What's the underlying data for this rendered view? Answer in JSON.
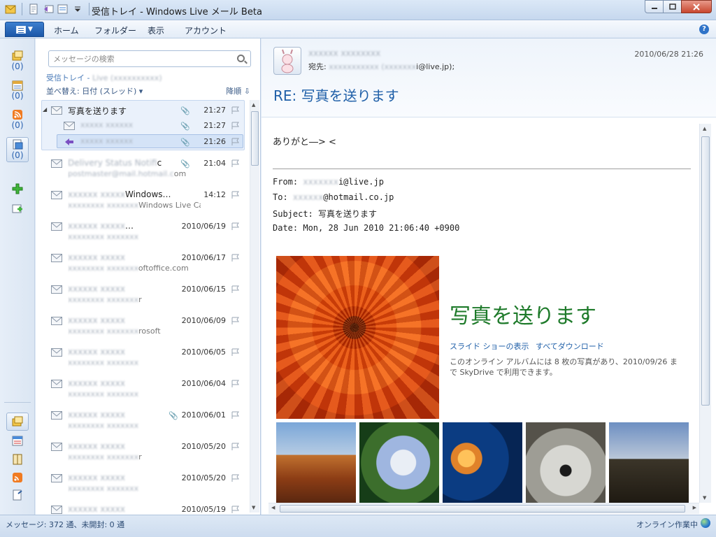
{
  "window": {
    "title": "受信トレイ - Windows Live メール Beta"
  },
  "ribbon": {
    "tabs": [
      "ホーム",
      "フォルダー",
      "表示",
      "アカウント"
    ],
    "help_label": "?"
  },
  "nav_rail": {
    "counts": [
      "(0)",
      "(0)",
      "(0)",
      "(0)"
    ]
  },
  "list": {
    "search_placeholder": "メッセージの検索",
    "folder_label": "受信トレイ - ",
    "folder_account": "Live (",
    "folder_account_suffix": ")",
    "sort_label": "並べ替え: 日付 (スレッド) ▾",
    "order_label": "降順 ⇩",
    "thread": {
      "subject": "写真を送ります",
      "time": "21:27",
      "replies": [
        {
          "from": "",
          "time": "21:27"
        },
        {
          "from": "",
          "time": "21:26"
        }
      ]
    },
    "messages": [
      {
        "subject_visible": "ic",
        "subject_hidden": "Delivery Status Notif",
        "from_visible": "om",
        "from_hidden": "postmaster@mail.hotmail.c",
        "time": "21:04",
        "attachment": true
      },
      {
        "subject_visible": "Windows…",
        "subject_hidden": "",
        "from_visible": "Windows Live Cal…",
        "from_hidden": "",
        "time": "14:12",
        "attachment": false
      },
      {
        "subject_visible": "…",
        "subject_hidden": "",
        "from_visible": "",
        "from_hidden": "",
        "time": "2010/06/19",
        "attachment": false
      },
      {
        "subject_visible": "",
        "subject_hidden": "",
        "from_visible": "oftoffice.com",
        "from_hidden": "",
        "time": "2010/06/17",
        "attachment": false
      },
      {
        "subject_visible": "",
        "subject_hidden": "",
        "from_visible": "r",
        "from_hidden": "",
        "time": "2010/06/15",
        "attachment": false
      },
      {
        "subject_visible": "",
        "subject_hidden": "",
        "from_visible": "rosoft",
        "from_hidden": "",
        "time": "2010/06/09",
        "attachment": false
      },
      {
        "subject_visible": "",
        "subject_hidden": "",
        "from_visible": "",
        "from_hidden": "",
        "time": "2010/06/05",
        "attachment": false
      },
      {
        "subject_visible": "",
        "subject_hidden": "",
        "from_visible": "",
        "from_hidden": "",
        "time": "2010/06/04",
        "attachment": false
      },
      {
        "subject_visible": "",
        "subject_hidden": "",
        "from_visible": "",
        "from_hidden": "",
        "time": "2010/06/01",
        "attachment": true
      },
      {
        "subject_visible": "",
        "subject_hidden": "",
        "from_visible": "r",
        "from_hidden": "",
        "time": "2010/05/20",
        "attachment": false
      },
      {
        "subject_visible": "",
        "subject_hidden": "",
        "from_visible": "",
        "from_hidden": "",
        "time": "2010/05/20",
        "attachment": false
      },
      {
        "subject_visible": "",
        "subject_hidden": "",
        "from_visible": "",
        "from_hidden": "",
        "time": "2010/05/19",
        "attachment": false
      }
    ]
  },
  "reading": {
    "sender_name": "",
    "to_prefix": "宛先: ",
    "to_value": "",
    "to_suffix": "i@live.jp);",
    "date": "2010/06/28 21:26",
    "subject": "RE: 写真を送ります",
    "body_line": "ありがと―> <",
    "header_from_prefix": "From: ",
    "header_from_suffix": "i@live.jp",
    "header_to_prefix": "To: ",
    "header_to_suffix": "@hotmail.co.jp",
    "header_subject": "Subject: 写真を送ります",
    "header_date": "Date: Mon, 28 Jun 2010 21:06:40 +0900",
    "album_title": "写真を送ります",
    "album_link_slideshow": "スライド ショーの表示",
    "album_link_download": "すべてダウンロード",
    "album_desc": "このオンライン アルバムには 8 枚の写真があり、2010/09/26 まで SkyDrive で利用できます。"
  },
  "status": {
    "left": "メッセージ: 372 通、未開封: 0 通",
    "right": "オンライン作業中"
  },
  "colors": {
    "accent": "#1f5fa8",
    "album_title": "#1e7a2a",
    "rail_count": "#2a62b0"
  }
}
